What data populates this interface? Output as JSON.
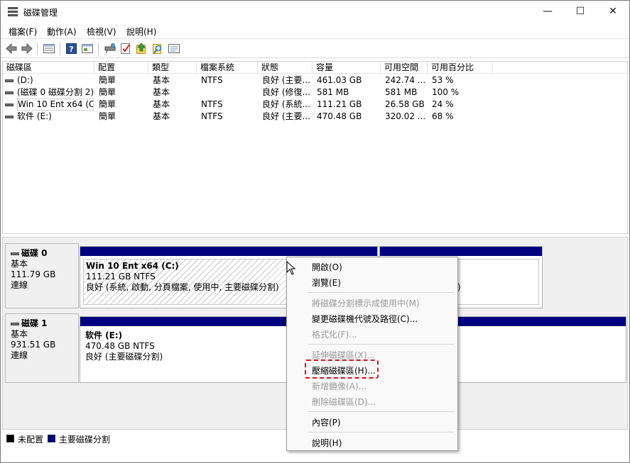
{
  "window": {
    "title": "磁碟管理",
    "minimize_glyph": "—",
    "maximize_glyph": "☐",
    "close_glyph": "✕"
  },
  "menu": [
    "檔案(F)",
    "動作(A)",
    "檢視(V)",
    "說明(H)"
  ],
  "toolbar": {
    "icons": [
      "back-icon",
      "forward-icon",
      "volume-list-icon",
      "help-icon",
      "console-icon",
      "connect-icon",
      "check-icon",
      "export-icon",
      "search-icon",
      "properties-icon"
    ]
  },
  "volume_list": {
    "columns": [
      "磁碟區",
      "配置",
      "類型",
      "檔案系統",
      "狀態",
      "容量",
      "可用空間",
      "可用百分比"
    ],
    "rows": [
      {
        "volume": "(D:)",
        "layout": "簡單",
        "type": "基本",
        "fs": "NTFS",
        "status": "良好 (主要...",
        "capacity": "461.03 GB",
        "free": "242.74 ...",
        "pct": "53 %"
      },
      {
        "volume": "(磁碟 0 磁碟分割 2)",
        "layout": "簡單",
        "type": "基本",
        "fs": "",
        "status": "良好 (修復...",
        "capacity": "581 MB",
        "free": "581 MB",
        "pct": "100 %"
      },
      {
        "volume": "Win 10 Ent x64 (C:)",
        "layout": "簡單",
        "type": "基本",
        "fs": "NTFS",
        "status": "良好 (系統...",
        "capacity": "111.21 GB",
        "free": "26.58 GB",
        "pct": "24 %"
      },
      {
        "volume": "软件 (E:)",
        "layout": "簡單",
        "type": "基本",
        "fs": "NTFS",
        "status": "良好 (主要...",
        "capacity": "470.48 GB",
        "free": "320.02 ...",
        "pct": "68 %"
      }
    ]
  },
  "disks": [
    {
      "title": "磁碟 0",
      "kind": "基本",
      "size": "111.79 GB",
      "state": "連線",
      "partition": {
        "name": "Win 10 Ent x64  (C:)",
        "size_fs": "111.21 GB NTFS",
        "status": "良好 (系統, 啟動, 分頁檔案, 使用中, 主要磁碟分割)"
      }
    },
    {
      "title": "磁碟 1",
      "kind": "基本",
      "size": "931.51 GB",
      "state": "連線",
      "partition": {
        "name": "软件  (E:)",
        "size_fs": "470.48 GB NTFS",
        "status": "良好 (主要磁碟分割)"
      }
    }
  ],
  "partial_text": ")",
  "legend": {
    "unallocated": "未配置",
    "primary": "主要磁碟分割",
    "unallocated_color": "#000000",
    "primary_color": "#00007f"
  },
  "context_menu": {
    "open": "開啟(O)",
    "explore": "瀏覽(E)",
    "mark_active": "將磁碟分割標示成使用中(M)",
    "change_letter": "變更磁碟機代號及路徑(C)...",
    "format": "格式化(F)...",
    "extend": "延伸磁碟區(X)...",
    "shrink": "壓縮磁碟區(H)...",
    "add_mirror": "新增鏡像(A)...",
    "delete": "刪除磁碟區(D)...",
    "properties": "內容(P)",
    "help": "說明(H)"
  }
}
